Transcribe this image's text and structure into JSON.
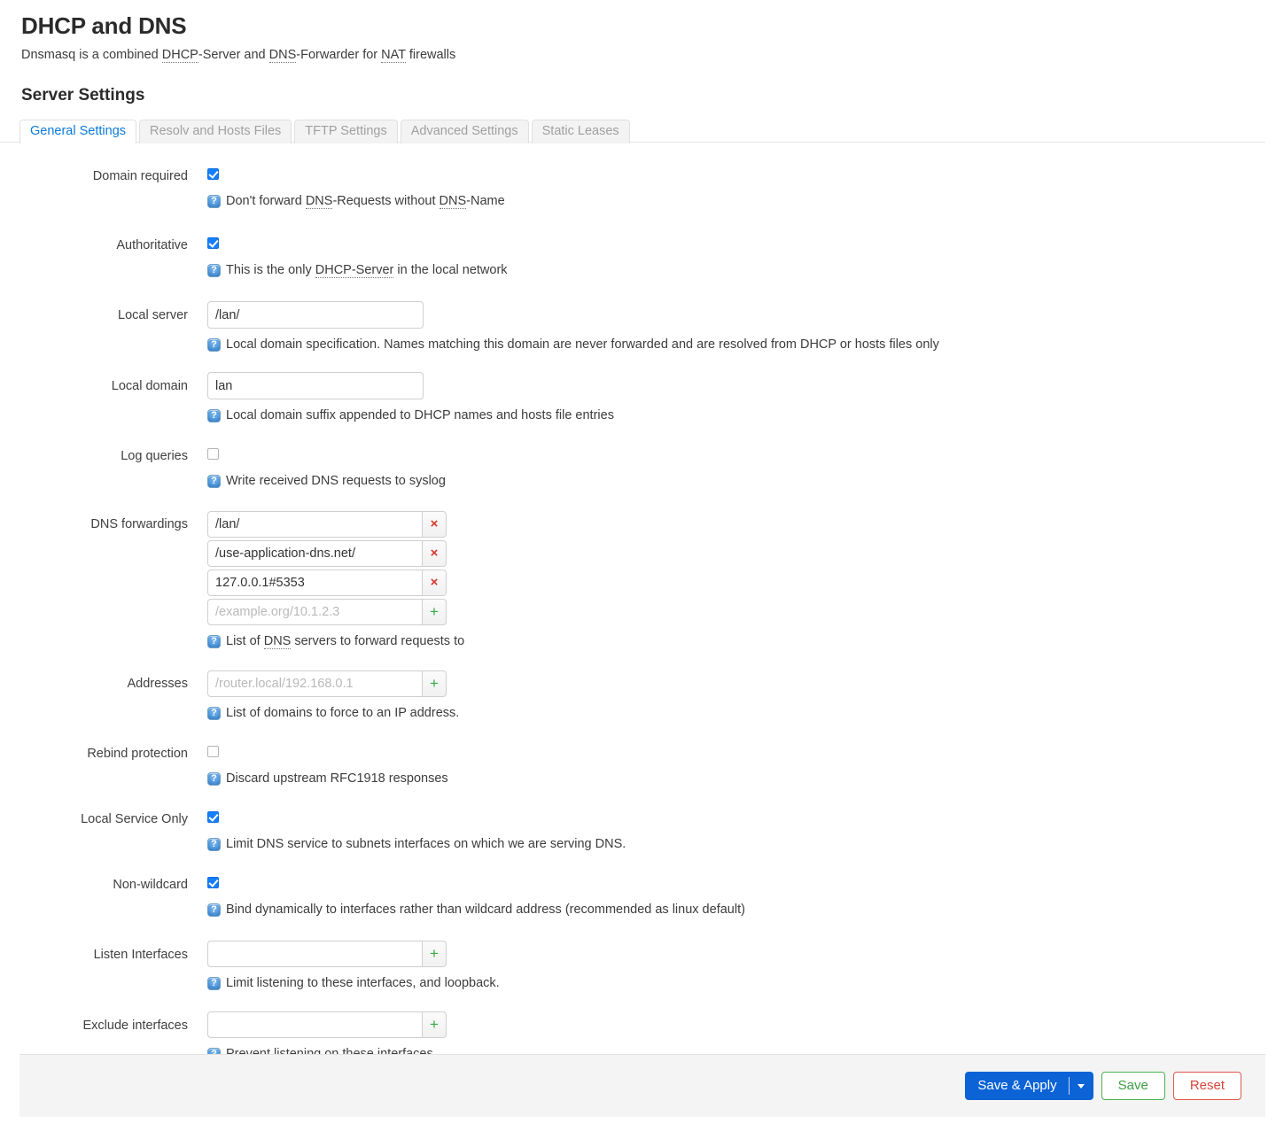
{
  "header": {
    "title": "DHCP and DNS",
    "subtitle_parts": [
      {
        "t": "Dnsmasq is a combined ",
        "abbr": false
      },
      {
        "t": "DHCP",
        "abbr": true
      },
      {
        "t": "-Server and ",
        "abbr": false
      },
      {
        "t": "DNS",
        "abbr": true
      },
      {
        "t": "-Forwarder for ",
        "abbr": false
      },
      {
        "t": "NAT",
        "abbr": true
      },
      {
        "t": " firewalls",
        "abbr": false
      }
    ],
    "subtitle_plain": "Dnsmasq is a combined DHCP-Server and DNS-Forwarder for NAT firewalls",
    "section_title": "Server Settings"
  },
  "tabs": [
    {
      "label": "General Settings",
      "active": true
    },
    {
      "label": "Resolv and Hosts Files",
      "active": false
    },
    {
      "label": "TFTP Settings",
      "active": false
    },
    {
      "label": "Advanced Settings",
      "active": false
    },
    {
      "label": "Static Leases",
      "active": false
    }
  ],
  "fields": {
    "domain_required": {
      "label": "Domain required",
      "checked": true,
      "desc": "Don't forward DNS-Requests without DNS-Name"
    },
    "authoritative": {
      "label": "Authoritative",
      "checked": true,
      "desc": "This is the only DHCP-Server in the local network"
    },
    "local_server": {
      "label": "Local server",
      "value": "/lan/",
      "desc": "Local domain specification. Names matching this domain are never forwarded and are resolved from DHCP or hosts files only"
    },
    "local_domain": {
      "label": "Local domain",
      "value": "lan",
      "desc": "Local domain suffix appended to DHCP names and hosts file entries"
    },
    "log_queries": {
      "label": "Log queries",
      "checked": false,
      "desc": "Write received DNS requests to syslog"
    },
    "dns_forwardings": {
      "label": "DNS forwardings",
      "entries": [
        "/lan/",
        "/use-application-dns.net/",
        "127.0.0.1#5353"
      ],
      "placeholder": "/example.org/10.1.2.3",
      "desc": "List of DNS servers to forward requests to",
      "remove_label": "×",
      "add_label": "+"
    },
    "addresses": {
      "label": "Addresses",
      "entries": [],
      "placeholder": "/router.local/192.168.0.1",
      "desc": "List of domains to force to an IP address.",
      "add_label": "+"
    },
    "rebind_protection": {
      "label": "Rebind protection",
      "checked": false,
      "desc": "Discard upstream RFC1918 responses"
    },
    "local_service_only": {
      "label": "Local Service Only",
      "checked": true,
      "desc": "Limit DNS service to subnets interfaces on which we are serving DNS."
    },
    "non_wildcard": {
      "label": "Non-wildcard",
      "checked": true,
      "desc": "Bind dynamically to interfaces rather than wildcard address (recommended as linux default)"
    },
    "listen_interfaces": {
      "label": "Listen Interfaces",
      "value": "",
      "placeholder": "",
      "desc": "Limit listening to these interfaces, and loopback.",
      "add_label": "+"
    },
    "exclude_interfaces": {
      "label": "Exclude interfaces",
      "value": "",
      "placeholder": "",
      "desc": "Prevent listening on these interfaces.",
      "add_label": "+"
    }
  },
  "footer": {
    "save_apply_label": "Save & Apply",
    "save_label": "Save",
    "reset_label": "Reset"
  },
  "colors": {
    "accent_blue": "#0b63d6",
    "tab_active": "#0a7adb",
    "green": "#3c9e42",
    "red": "#d9453b",
    "checkbox_on": "#157efb"
  }
}
